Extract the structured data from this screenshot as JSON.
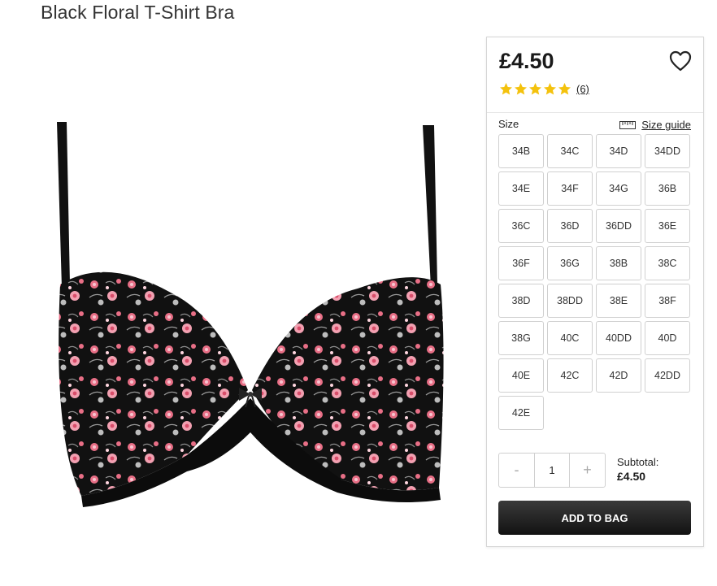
{
  "product": {
    "title": "Black Floral T-Shirt Bra",
    "image_alt": "black floral print bra product photo"
  },
  "buy_box": {
    "price": "£4.50",
    "wishlist_icon": "heart-outline-icon",
    "rating": {
      "stars": 5,
      "max": 5,
      "review_count": "(6)",
      "star_color": "#f4c20d"
    },
    "size_label": "Size",
    "size_guide_label": "Size guide",
    "size_guide_icon": "ruler-icon",
    "sizes": [
      "34B",
      "34C",
      "34D",
      "34DD",
      "34E",
      "34F",
      "34G",
      "36B",
      "36C",
      "36D",
      "36DD",
      "36E",
      "36F",
      "36G",
      "38B",
      "38C",
      "38D",
      "38DD",
      "38E",
      "38F",
      "38G",
      "40C",
      "40DD",
      "40D",
      "40E",
      "42C",
      "42D",
      "42DD",
      "42E"
    ],
    "quantity": {
      "minus": "-",
      "value": "1",
      "plus": "+"
    },
    "subtotal_label": "Subtotal:",
    "subtotal_value": "£4.50",
    "add_to_bag_label": "ADD TO BAG",
    "button_color": "#1f1f1f"
  }
}
